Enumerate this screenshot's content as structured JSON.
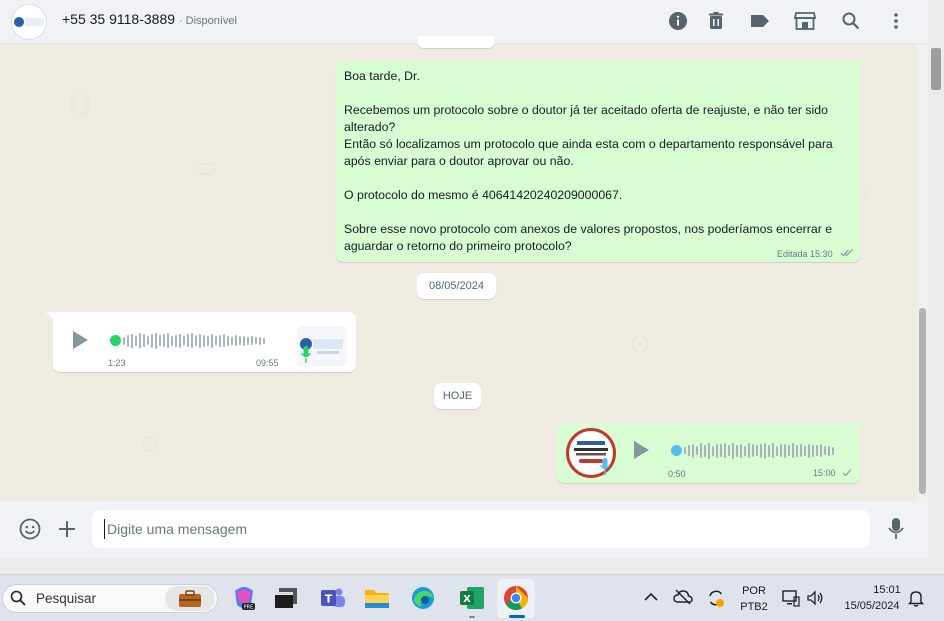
{
  "header": {
    "contact_number": "+55 35 9118-3889",
    "status": "· Disponível",
    "avatar_logo": "Oral Clinic"
  },
  "messages": {
    "outgoing_text": {
      "greeting": "Boa tarde, Dr.",
      "p1": "Recebemos um protocolo sobre o doutor já ter aceitado oferta de reajuste, e não ter sido alterado?",
      "p2": "Então só localizamos um protocolo que ainda esta com o departamento responsável para após enviar para o doutor aprovar ou não.",
      "p3": "O protocolo do mesmo é 40641420240209000067.",
      "p4": "Sobre esse novo protocolo com anexos de valores propostos, nos poderíamos encerrar e aguardar o retorno do primeiro protocolo?",
      "meta_edited": "Editada",
      "time": "15:30"
    },
    "date_chip_1": "08/05/2024",
    "incoming_audio": {
      "duration": "1:23",
      "time": "09:55",
      "avatar_logo": "Oral Clinic"
    },
    "date_chip_2": "HOJE",
    "outgoing_audio": {
      "duration": "0:50",
      "time": "15:00"
    }
  },
  "compose": {
    "placeholder": "Digite uma mensagem"
  },
  "taskbar": {
    "search_label": "Pesquisar",
    "language_top": "POR",
    "language_bottom": "PTB2",
    "clock_time": "15:01",
    "clock_date": "15/05/2024"
  },
  "colors": {
    "outgoing_bubble": "#d9fdd3",
    "incoming_bubble": "#ffffff",
    "chat_background": "#efeae2",
    "audio_dot_green": "#25d366",
    "audio_dot_blue": "#53bdeb"
  }
}
